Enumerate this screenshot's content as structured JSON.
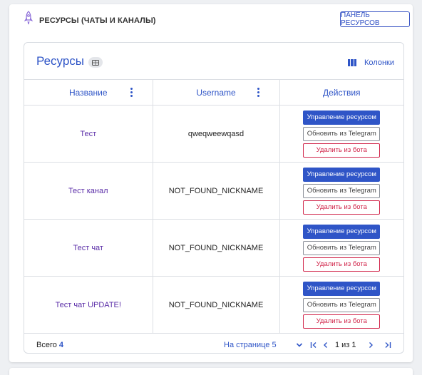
{
  "header": {
    "title": "РЕСУРСЫ (ЧАТЫ И КАНАЛЫ)",
    "panel_button": "ПАНЕЛЬ РЕСУРСОВ"
  },
  "card": {
    "title": "Ресурсы",
    "columns_button": "Колонки"
  },
  "table": {
    "headers": {
      "name": "Название",
      "username": "Username",
      "actions": "Действия"
    },
    "rows": [
      {
        "name": "Тест",
        "username": "qweqweewqasd"
      },
      {
        "name": "Тест канал",
        "username": "NOT_FOUND_NICKNAME"
      },
      {
        "name": "Тест чат",
        "username": "NOT_FOUND_NICKNAME"
      },
      {
        "name": "Тест чат UPDATE!",
        "username": "NOT_FOUND_NICKNAME"
      }
    ],
    "actions": {
      "manage": "Управление ресурсом",
      "update": "Обновить из Telegram",
      "delete": "Удалить из бота"
    }
  },
  "footer": {
    "total_label": "Всего",
    "total_value": "4",
    "per_page_label": "На странице",
    "per_page_value": "5",
    "page_info": "1 из 1"
  },
  "colors": {
    "accent": "#2f55c7",
    "danger": "#d1264b",
    "name_text": "#5b2ea8"
  },
  "icons": {
    "header": "rocket-icon",
    "count_badge": "list-badge-icon",
    "columns": "columns-icon",
    "column_menu": "more-vertical-icon",
    "per_page": "chevron-down-icon",
    "first": "first-page-icon",
    "prev": "chevron-left-icon",
    "next": "chevron-right-icon",
    "last": "last-page-icon"
  }
}
